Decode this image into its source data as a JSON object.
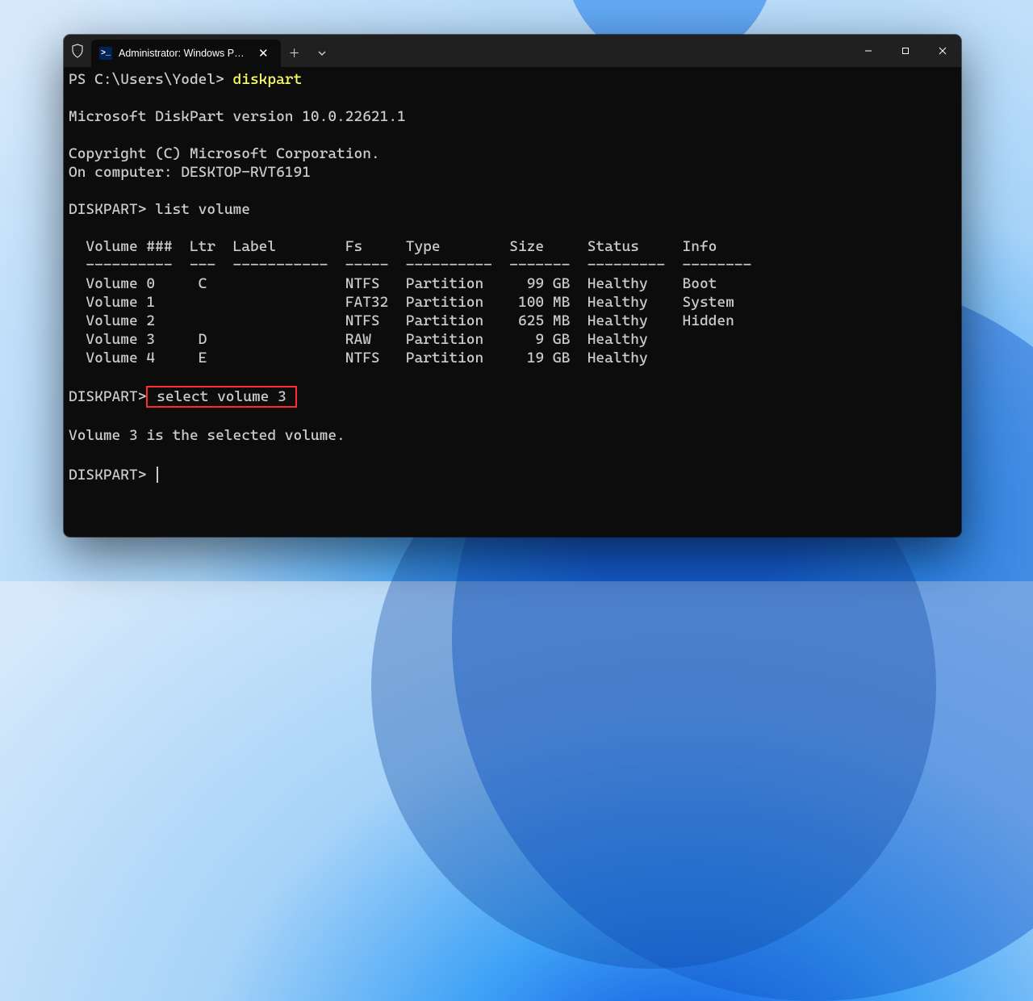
{
  "tab": {
    "title": "Administrator: Windows Powe",
    "icon_text": ">_"
  },
  "shell": {
    "ps_prompt": "PS C:\\Users\\Yodel> ",
    "ps_cmd": "diskpart",
    "banner_version": "Microsoft DiskPart version 10.0.22621.1",
    "copyright": "Copyright (C) Microsoft Corporation.",
    "computer": "On computer: DESKTOP-RVT6191",
    "dp_prompt1": "DISKPART> ",
    "dp_cmd1": "list volume",
    "table_header": "  Volume ###  Ltr  Label        Fs     Type        Size     Status     Info",
    "table_divider": "  ----------  ---  -----------  -----  ----------  -------  ---------  --------",
    "volumes": [
      {
        "line": "  Volume 0     C                NTFS   Partition     99 GB  Healthy    Boot",
        "num": 0,
        "ltr": "C",
        "label": "",
        "fs": "NTFS",
        "type": "Partition",
        "size": "99 GB",
        "status": "Healthy",
        "info": "Boot"
      },
      {
        "line": "  Volume 1                      FAT32  Partition    100 MB  Healthy    System",
        "num": 1,
        "ltr": "",
        "label": "",
        "fs": "FAT32",
        "type": "Partition",
        "size": "100 MB",
        "status": "Healthy",
        "info": "System"
      },
      {
        "line": "  Volume 2                      NTFS   Partition    625 MB  Healthy    Hidden",
        "num": 2,
        "ltr": "",
        "label": "",
        "fs": "NTFS",
        "type": "Partition",
        "size": "625 MB",
        "status": "Healthy",
        "info": "Hidden"
      },
      {
        "line": "  Volume 3     D                RAW    Partition      9 GB  Healthy",
        "num": 3,
        "ltr": "D",
        "label": "",
        "fs": "RAW",
        "type": "Partition",
        "size": "9 GB",
        "status": "Healthy",
        "info": ""
      },
      {
        "line": "  Volume 4     E                NTFS   Partition     19 GB  Healthy",
        "num": 4,
        "ltr": "E",
        "label": "",
        "fs": "NTFS",
        "type": "Partition",
        "size": "19 GB",
        "status": "Healthy",
        "info": ""
      }
    ],
    "dp_prompt2": "DISKPART>",
    "dp_cmd2": " select volume 3 ",
    "select_result": "Volume 3 is the selected volume.",
    "dp_prompt3": "DISKPART> "
  },
  "colors": {
    "cmd_yellow": "#ffff66",
    "highlight_red": "#ff2d2d"
  }
}
